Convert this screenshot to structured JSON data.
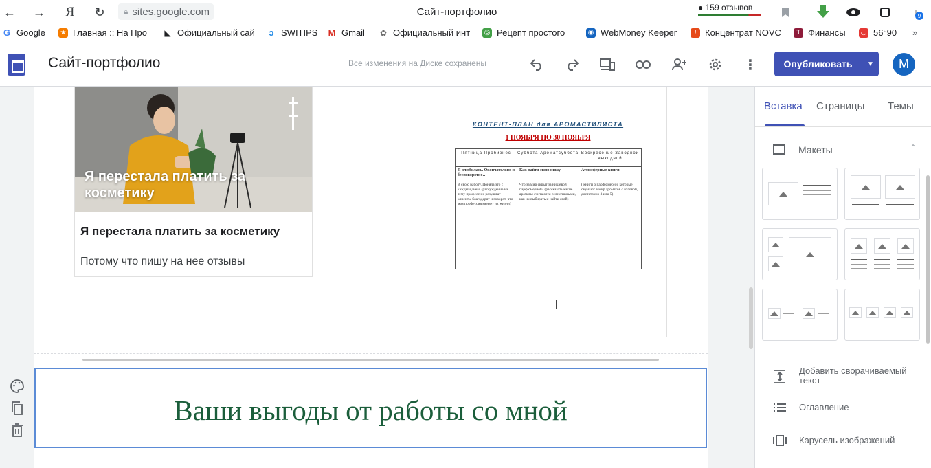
{
  "browser": {
    "url": "sites.google.com",
    "tab_title": "Сайт-портфолио",
    "reviews": "159 отзывов",
    "download_badge": "9"
  },
  "bookmarks": [
    {
      "label": "Google",
      "color": "#4285f4",
      "glyph": "G"
    },
    {
      "label": "Главная :: На Про",
      "color": "#f57c00",
      "glyph": "★"
    },
    {
      "label": "Официальный сай",
      "color": "#202124",
      "glyph": "◣"
    },
    {
      "label": "SWITIPS",
      "color": "#1e88e5",
      "glyph": "ↄ"
    },
    {
      "label": "Gmail",
      "color": "#d93025",
      "glyph": "M"
    },
    {
      "label": "Официальный инт",
      "color": "#6d6d6d",
      "glyph": "✿"
    },
    {
      "label": "Рецепт простого",
      "color": "#43a047",
      "glyph": "◎"
    },
    {
      "label": "WebMoney Keeper",
      "color": "#1565c0",
      "glyph": "◉"
    },
    {
      "label": "Концентрат NOVC",
      "color": "#e64a19",
      "glyph": "!"
    },
    {
      "label": "Финансы",
      "color": "#8e1b3a",
      "glyph": "T"
    },
    {
      "label": "56°90",
      "color": "#e53935",
      "glyph": "◡"
    }
  ],
  "app": {
    "title": "Сайт-портфолио",
    "save_status": "Все изменения на Диске сохранены",
    "publish_label": "Опубликовать",
    "avatar_letter": "M"
  },
  "card": {
    "overlay_text": "Я перестала платить за косметику",
    "title": "Я перестала платить за косметику",
    "description": "Потому что пишу на нее отзывы"
  },
  "doc": {
    "heading": "КОНТЕНТ-ПЛАН для АРОМАСТИЛИСТА",
    "dates": "1 НОЯБРЯ ПО 30 НОЯБРЯ",
    "columns": [
      {
        "head": "Пятница Пробизнес",
        "bold": "Я влюбилась. Окончательно и бесповоротно…",
        "text": "В свою работу. Поняла это с каждым днем. (рассуждение на тему профессии, результат - клиенты благодарят и говорят, что моя профессия меняет их жизни)"
      },
      {
        "head": "Суббота Ароматсуббота",
        "bold": "Как найти свою нишу",
        "text": "Что за мир скрыт за нишевой парфюмерией? (рассказать какие ароматы считаются селективными, как их выбирать и найти свой)"
      },
      {
        "head": "Воскресенье Заводной выходной",
        "bold": "Атмосферные книги",
        "text": "( книги о парфюмерии, которые окунают в мир ароматов с головой, достаточно 3 или 5)"
      }
    ]
  },
  "section": {
    "heading": "Ваши выгоды от работы со мной"
  },
  "panel": {
    "tabs": [
      "Вставка",
      "Страницы",
      "Темы"
    ],
    "active_tab": "Вставка",
    "layouts_label": "Макеты",
    "items": [
      {
        "label": "Добавить сворачиваемый текст",
        "icon": "collapsible-text-icon"
      },
      {
        "label": "Оглавление",
        "icon": "table-of-contents-icon"
      },
      {
        "label": "Карусель изображений",
        "icon": "image-carousel-icon"
      }
    ]
  },
  "colors": {
    "accent": "#3f51b5",
    "heading_green": "#1b5e3b",
    "selection_blue": "#5b8bd6"
  }
}
